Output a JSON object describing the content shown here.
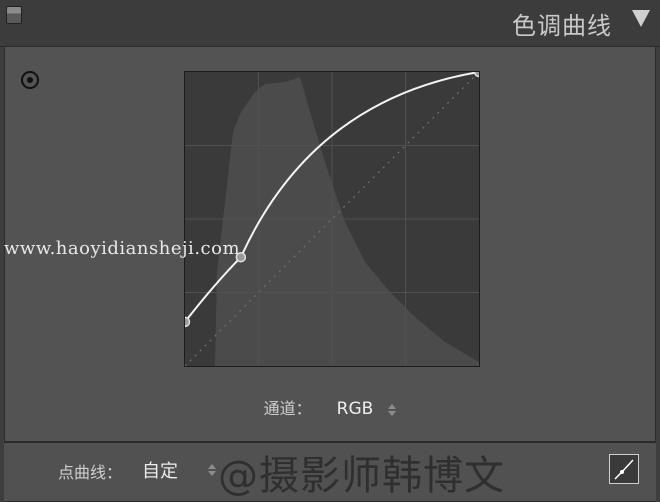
{
  "panel": {
    "title": "色调曲线",
    "toggle_icon": "panel-toggle-icon",
    "collapse_icon": "triangle-down-icon"
  },
  "tool": {
    "icon": "target-adjust-icon"
  },
  "channel": {
    "label": "通道：",
    "value": "RGB"
  },
  "point_curve": {
    "label": "点曲线：",
    "value": "自定"
  },
  "watermark": {
    "url": "www.haoyidiansheji.com",
    "credit": "@摄影师韩博文"
  },
  "curve_points": [
    {
      "input": 0,
      "output": 0.15
    },
    {
      "input": 0.19,
      "output": 0.37
    },
    {
      "input": 1,
      "output": 1
    }
  ],
  "colors": {
    "panel_bg": "#535353",
    "graph_bg": "#3c3c3c",
    "histogram": "#4a4a4a",
    "curve": "#f4f4f4"
  }
}
